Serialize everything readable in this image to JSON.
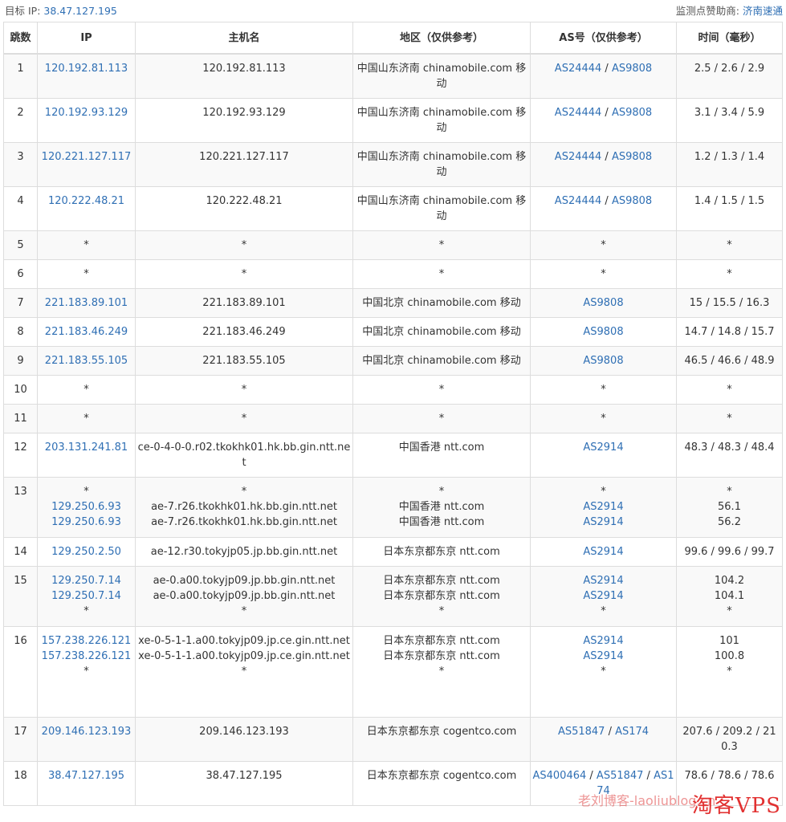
{
  "header": {
    "target_label": "目标 IP:",
    "target_ip": "38.47.127.195",
    "sponsor_label": "监测点赞助商:",
    "sponsor_name": "济南速通"
  },
  "table": {
    "headers": [
      "跳数",
      "IP",
      "主机名",
      "地区（仅供参考）",
      "AS号（仅供参考）",
      "时间（毫秒）"
    ],
    "rows": [
      {
        "hop": "1",
        "ip": [
          "120.192.81.113"
        ],
        "host": [
          "120.192.81.113"
        ],
        "region": [
          "中国山东济南 chinamobile.com 移动"
        ],
        "as": [
          [
            "AS24444",
            "AS9808"
          ]
        ],
        "time": [
          "2.5 / 2.6 / 2.9"
        ]
      },
      {
        "hop": "2",
        "ip": [
          "120.192.93.129"
        ],
        "host": [
          "120.192.93.129"
        ],
        "region": [
          "中国山东济南 chinamobile.com 移动"
        ],
        "as": [
          [
            "AS24444",
            "AS9808"
          ]
        ],
        "time": [
          "3.1 / 3.4 / 5.9"
        ]
      },
      {
        "hop": "3",
        "ip": [
          "120.221.127.117"
        ],
        "host": [
          "120.221.127.117"
        ],
        "region": [
          "中国山东济南 chinamobile.com 移动"
        ],
        "as": [
          [
            "AS24444",
            "AS9808"
          ]
        ],
        "time": [
          "1.2 / 1.3 / 1.4"
        ]
      },
      {
        "hop": "4",
        "ip": [
          "120.222.48.21"
        ],
        "host": [
          "120.222.48.21"
        ],
        "region": [
          "中国山东济南 chinamobile.com 移动"
        ],
        "as": [
          [
            "AS24444",
            "AS9808"
          ]
        ],
        "time": [
          "1.4 / 1.5 / 1.5"
        ]
      },
      {
        "hop": "5",
        "ip": [
          "*"
        ],
        "host": [
          "*"
        ],
        "region": [
          "*"
        ],
        "as": [
          [
            "*"
          ]
        ],
        "time": [
          "*"
        ]
      },
      {
        "hop": "6",
        "ip": [
          "*"
        ],
        "host": [
          "*"
        ],
        "region": [
          "*"
        ],
        "as": [
          [
            "*"
          ]
        ],
        "time": [
          "*"
        ]
      },
      {
        "hop": "7",
        "ip": [
          "221.183.89.101"
        ],
        "host": [
          "221.183.89.101"
        ],
        "region": [
          "中国北京 chinamobile.com 移动"
        ],
        "as": [
          [
            "AS9808"
          ]
        ],
        "time": [
          "15 / 15.5 / 16.3"
        ]
      },
      {
        "hop": "8",
        "ip": [
          "221.183.46.249"
        ],
        "host": [
          "221.183.46.249"
        ],
        "region": [
          "中国北京 chinamobile.com 移动"
        ],
        "as": [
          [
            "AS9808"
          ]
        ],
        "time": [
          "14.7 / 14.8 / 15.7"
        ]
      },
      {
        "hop": "9",
        "ip": [
          "221.183.55.105"
        ],
        "host": [
          "221.183.55.105"
        ],
        "region": [
          "中国北京 chinamobile.com 移动"
        ],
        "as": [
          [
            "AS9808"
          ]
        ],
        "time": [
          "46.5 / 46.6 / 48.9"
        ]
      },
      {
        "hop": "10",
        "ip": [
          "*"
        ],
        "host": [
          "*"
        ],
        "region": [
          "*"
        ],
        "as": [
          [
            "*"
          ]
        ],
        "time": [
          "*"
        ]
      },
      {
        "hop": "11",
        "ip": [
          "*"
        ],
        "host": [
          "*"
        ],
        "region": [
          "*"
        ],
        "as": [
          [
            "*"
          ]
        ],
        "time": [
          "*"
        ]
      },
      {
        "hop": "12",
        "ip": [
          "203.131.241.81"
        ],
        "host": [
          "ce-0-4-0-0.r02.tkokhk01.hk.bb.gin.ntt.net"
        ],
        "region": [
          "中国香港 ntt.com"
        ],
        "as": [
          [
            "AS2914"
          ]
        ],
        "time": [
          "48.3 / 48.3 / 48.4"
        ]
      },
      {
        "hop": "13",
        "ip": [
          "*",
          "129.250.6.93",
          "129.250.6.93"
        ],
        "host": [
          "*",
          "ae-7.r26.tkokhk01.hk.bb.gin.ntt.net",
          "ae-7.r26.tkokhk01.hk.bb.gin.ntt.net"
        ],
        "region": [
          "*",
          "中国香港 ntt.com",
          "中国香港 ntt.com"
        ],
        "as": [
          [
            "*"
          ],
          [
            "AS2914"
          ],
          [
            "AS2914"
          ]
        ],
        "time": [
          "*",
          "56.1",
          "56.2"
        ]
      },
      {
        "hop": "14",
        "ip": [
          "129.250.2.50"
        ],
        "host": [
          "ae-12.r30.tokyjp05.jp.bb.gin.ntt.net"
        ],
        "region": [
          "日本东京都东京 ntt.com"
        ],
        "as": [
          [
            "AS2914"
          ]
        ],
        "time": [
          "99.6 / 99.6 / 99.7"
        ]
      },
      {
        "hop": "15",
        "ip": [
          "129.250.7.14",
          "129.250.7.14",
          "*"
        ],
        "host": [
          "ae-0.a00.tokyjp09.jp.bb.gin.ntt.net",
          "ae-0.a00.tokyjp09.jp.bb.gin.ntt.net",
          "*"
        ],
        "region": [
          "日本东京都东京 ntt.com",
          "日本东京都东京 ntt.com",
          "*"
        ],
        "as": [
          [
            "AS2914"
          ],
          [
            "AS2914"
          ],
          [
            "*"
          ]
        ],
        "time": [
          "104.2",
          "104.1",
          "*"
        ]
      },
      {
        "hop": "16",
        "ip": [
          "157.238.226.121",
          "157.238.226.121",
          "*"
        ],
        "host": [
          "xe-0-5-1-1.a00.tokyjp09.jp.ce.gin.ntt.net",
          "xe-0-5-1-1.a00.tokyjp09.jp.ce.gin.ntt.net",
          "*"
        ],
        "region": [
          "日本东京都东京 ntt.com",
          "日本东京都东京 ntt.com",
          "*"
        ],
        "as": [
          [
            "AS2914"
          ],
          [
            "AS2914"
          ],
          [
            "*"
          ]
        ],
        "time": [
          "101",
          "100.8",
          "*"
        ]
      },
      {
        "hop": "17",
        "ip": [
          "209.146.123.193"
        ],
        "host": [
          "209.146.123.193"
        ],
        "region": [
          "日本东京都东京 cogentco.com"
        ],
        "as": [
          [
            "AS51847",
            "AS174"
          ]
        ],
        "time": [
          "207.6 / 209.2 / 210.3"
        ]
      },
      {
        "hop": "18",
        "ip": [
          "38.47.127.195"
        ],
        "host": [
          "38.47.127.195"
        ],
        "region": [
          "日本东京都东京 cogentco.com"
        ],
        "as": [
          [
            "AS400464",
            "AS51847",
            "AS174"
          ]
        ],
        "time": [
          "78.6 / 78.6 / 78.6"
        ]
      }
    ]
  },
  "watermark": {
    "text": "淘客VPS",
    "blog": "老刘博客-laoliublog.cn"
  },
  "colors": {
    "link": "#2f6fb4",
    "stripe": "#f9f9f9",
    "border": "#dddddd",
    "watermark": "#e02020"
  }
}
